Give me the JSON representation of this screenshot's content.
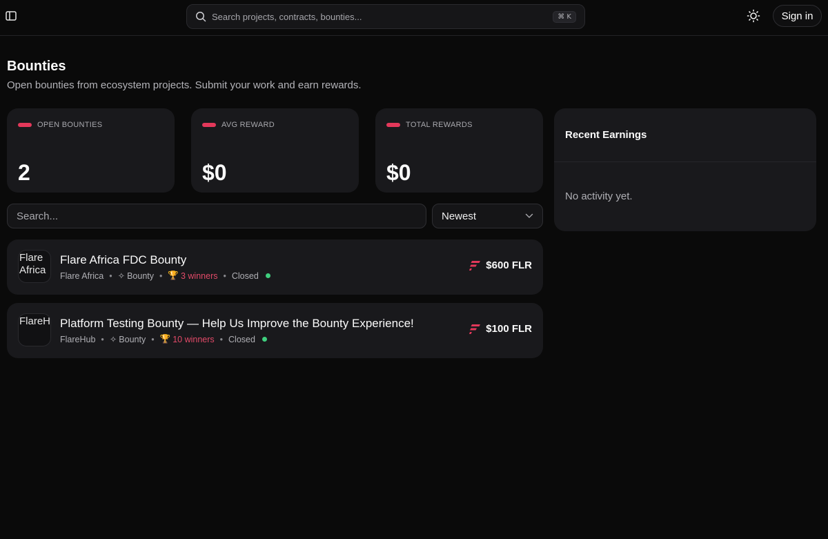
{
  "header": {
    "search_placeholder": "Search projects, contracts, bounties...",
    "search_shortcut": "⌘ K",
    "signin_label": "Sign in"
  },
  "page": {
    "title": "Bounties",
    "subtitle": "Open bounties from ecosystem projects. Submit your work and earn rewards."
  },
  "stats": [
    {
      "label": "OPEN BOUNTIES",
      "value": "2"
    },
    {
      "label": "AVG REWARD",
      "value": "$0"
    },
    {
      "label": "TOTAL REWARDS",
      "value": "$0"
    }
  ],
  "earnings": {
    "title": "Recent Earnings",
    "empty_text": "No activity yet."
  },
  "filters": {
    "search_placeholder": "Search...",
    "sort_value": "Newest"
  },
  "bounties": [
    {
      "avatar_alt": "Flare Africa",
      "title": "Flare Africa FDC Bounty",
      "org": "Flare Africa",
      "type": "Bounty",
      "winners": "3 winners",
      "status": "Closed",
      "reward": "$600 FLR"
    },
    {
      "avatar_alt": "FlareHub",
      "title": "Platform Testing Bounty — Help Us Improve the Bounty Experience!",
      "org": "FlareHub",
      "type": "Bounty",
      "winners": "10 winners",
      "status": "Closed",
      "reward": "$100 FLR"
    }
  ],
  "colors": {
    "accent": "#e3385a",
    "status_open": "#3fcf7e",
    "background": "#0a0a0a",
    "card": "#19191c"
  },
  "icons": [
    "sidebar-toggle-icon",
    "search-icon",
    "sun-icon",
    "chevron-down-icon",
    "sparkle-icon",
    "trophy-icon",
    "flare-logo-icon"
  ]
}
